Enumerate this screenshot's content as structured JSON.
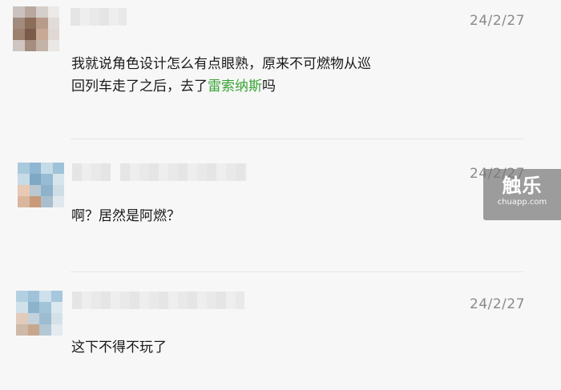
{
  "comments": [
    {
      "date": "24/2/27",
      "text_before": "我就说角色设计怎么有点眼熟，原来不可燃物从巡",
      "text_line2_before": "回列车走了之后，去了",
      "highlight": "雷索纳斯",
      "text_after": "吗",
      "avatar_colors": [
        "#c9c2bf",
        "#b9a79d",
        "#d5cfcb",
        "#ece9e7",
        "#a18b7e",
        "#8b6d5a",
        "#b89c8a",
        "#e2dcd8",
        "#9c8070",
        "#7a5b49",
        "#c7a996",
        "#dfd8d3",
        "#cfc6c1",
        "#a58d7f",
        "#c3b3a8",
        "#ebe7e5"
      ]
    },
    {
      "date": "24/2/27",
      "text": "啊？居然是阿燃？",
      "avatar_colors": [
        "#a9c9dd",
        "#8fb7d1",
        "#c4dbe8",
        "#9ec2d8",
        "#c7dbe7",
        "#7fa8c4",
        "#96bcd3",
        "#d6e4ec",
        "#e7c9b5",
        "#b9c8d1",
        "#8eb2c9",
        "#cfdde6",
        "#d8b79e",
        "#c99a78",
        "#a9bfcd",
        "#e0e8ee"
      ]
    },
    {
      "date": "24/2/27",
      "text": "这下不得不玩了",
      "avatar_colors": [
        "#b3d0e2",
        "#9fc2d9",
        "#cde0eb",
        "#a7c7dc",
        "#d0e1ea",
        "#8db3cc",
        "#a2c4d9",
        "#dce8ef",
        "#e2cbbb",
        "#c2d2dc",
        "#9ebcd0",
        "#d4e1e9",
        "#cfb9a8",
        "#c8a68e",
        "#b3c7d4",
        "#e3ebf0"
      ]
    }
  ],
  "watermark": {
    "logo": "触乐",
    "url": "chuapp.com"
  }
}
